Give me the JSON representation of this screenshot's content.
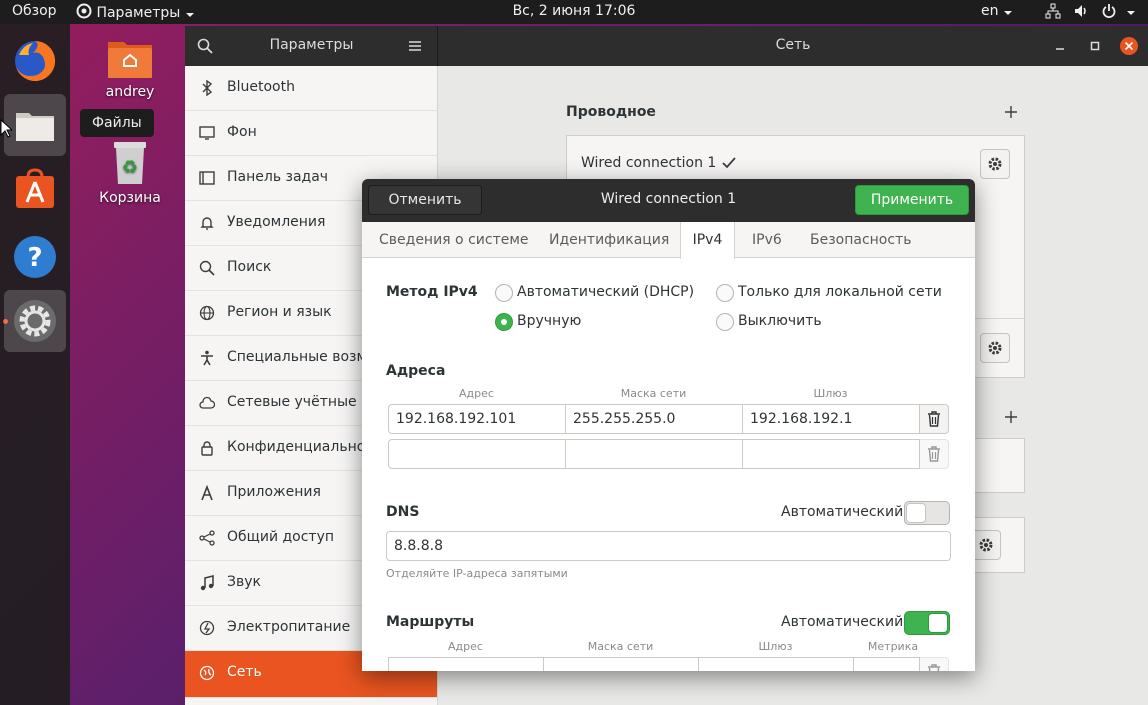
{
  "topbar": {
    "activities": "Обзор",
    "app_menu": "Параметры",
    "clock": "Вс, 2 июня  17:06",
    "language": "en"
  },
  "dock": {
    "tooltip": "Файлы",
    "items": [
      "firefox-icon",
      "files-icon",
      "software-center-icon",
      "help-icon",
      "settings-icon"
    ]
  },
  "desktop": {
    "home_label": "andrey",
    "trash_label": "Корзина"
  },
  "settings": {
    "sidebar_title": "Параметры",
    "panel_title": "Сеть",
    "sidebar_items": [
      {
        "label": "Bluetooth",
        "icon": "bluetooth-icon"
      },
      {
        "label": "Фон",
        "icon": "background-icon"
      },
      {
        "label": "Панель задач",
        "icon": "dock-icon"
      },
      {
        "label": "Уведомления",
        "icon": "bell-icon"
      },
      {
        "label": "Поиск",
        "icon": "search-icon"
      },
      {
        "label": "Регион и язык",
        "icon": "globe-icon"
      },
      {
        "label": "Специальные возм",
        "icon": "accessibility-icon"
      },
      {
        "label": "Сетевые учётные за",
        "icon": "cloud-icon"
      },
      {
        "label": "Конфиденциально",
        "icon": "lock-icon"
      },
      {
        "label": "Приложения",
        "icon": "apps-icon"
      },
      {
        "label": "Общий доступ",
        "icon": "share-icon"
      },
      {
        "label": "Звук",
        "icon": "music-icon"
      },
      {
        "label": "Электропитание",
        "icon": "power-icon"
      },
      {
        "label": "Сеть",
        "icon": "network-icon"
      }
    ],
    "wired_heading": "Проводное",
    "wired_connection": "Wired connection 1"
  },
  "dialog": {
    "title": "Wired connection 1",
    "cancel": "Отменить",
    "apply": "Применить",
    "tabs": [
      "Сведения о системе",
      "Идентификация",
      "IPv4",
      "IPv6",
      "Безопасность"
    ],
    "method_label": "Метод IPv4",
    "methods": [
      "Автоматический (DHCP)",
      "Только для локальной сети",
      "Вручную",
      "Выключить"
    ],
    "addresses_label": "Адреса",
    "addr_headers": [
      "Адрес",
      "Маска сети",
      "Шлюз"
    ],
    "address_rows": [
      [
        "192.168.192.101",
        "255.255.255.0",
        "192.168.192.1"
      ],
      [
        "",
        "",
        ""
      ]
    ],
    "dns_label": "DNS",
    "automatic": "Автоматический",
    "dns_value": "8.8.8.8",
    "dns_hint": "Отделяйте IP-адреса запятыми",
    "routes_label": "Маршруты",
    "route_headers": [
      "Адрес",
      "Маска сети",
      "Шлюз",
      "Метрика"
    ],
    "dns_auto": false,
    "routes_auto": true,
    "accent": "#e95420",
    "green": "#3eb34f"
  }
}
